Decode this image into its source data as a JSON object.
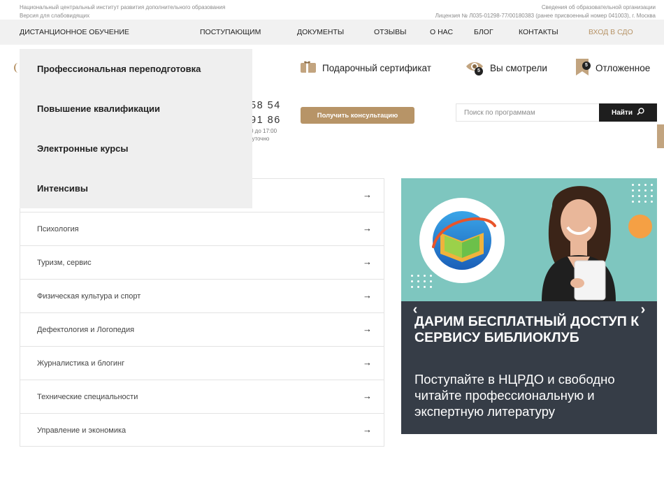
{
  "topbar": {
    "institute": "Национальный центральный институт развития дополнительного образования",
    "low_vision": "Версия для слабовидящих",
    "edu_info": "Сведения об образовательной организации",
    "license": "Лицензия № Л035-01298-77/00180383 (ранее присвоенный номер 041003), г. Москва"
  },
  "nav": {
    "items": [
      "Дистанционное обучение",
      "Поступающим",
      "Документы",
      "Отзывы",
      "О нас",
      "Блог",
      "Контакты"
    ],
    "login": "Вход в СДО"
  },
  "dropdown": {
    "items": [
      "Профессиональная переподготовка",
      "Повышение квалификации",
      "Электронные курсы",
      "Интенсивы"
    ]
  },
  "utility": {
    "gift": "Подарочный сертификат",
    "viewed": "Вы смотрели",
    "viewed_count": "5",
    "saved": "Отложенное",
    "saved_count": "5"
  },
  "contacts": {
    "phone1": "58 54",
    "phone2": "91 86",
    "note1": "0 до 17:00",
    "note2": "осуточно"
  },
  "consult_button": "Получить консультацию",
  "search": {
    "placeholder": "Поиск по программам",
    "button": "Найти"
  },
  "categories": [
    {
      "label": ""
    },
    {
      "label": "Психология"
    },
    {
      "label": "Туризм, сервис"
    },
    {
      "label": "Физическая культура и спорт"
    },
    {
      "label": "Дефектология и Логопедия"
    },
    {
      "label": "Журналистика и блогинг"
    },
    {
      "label": "Технические специальности"
    },
    {
      "label": "Управление и экономика"
    }
  ],
  "banner": {
    "headline": "Дарим бесплатный доступ к сервису Библиоклуб",
    "subtitle": "Поступайте в НЦРДО и свободно читайте профессиональную и экспертную литературу"
  },
  "colors": {
    "accent": "#b79467",
    "nav_bg": "#f1f1f1",
    "banner_teal": "#7ec6bf",
    "banner_dark": "#363d47",
    "search_button": "#1e1e1e"
  },
  "icons": {
    "gift": "gift-card-icon",
    "viewed": "eye-icon",
    "saved": "bookmark-icon",
    "search": "magnifier-icon",
    "arrow": "arrow-right-icon"
  }
}
